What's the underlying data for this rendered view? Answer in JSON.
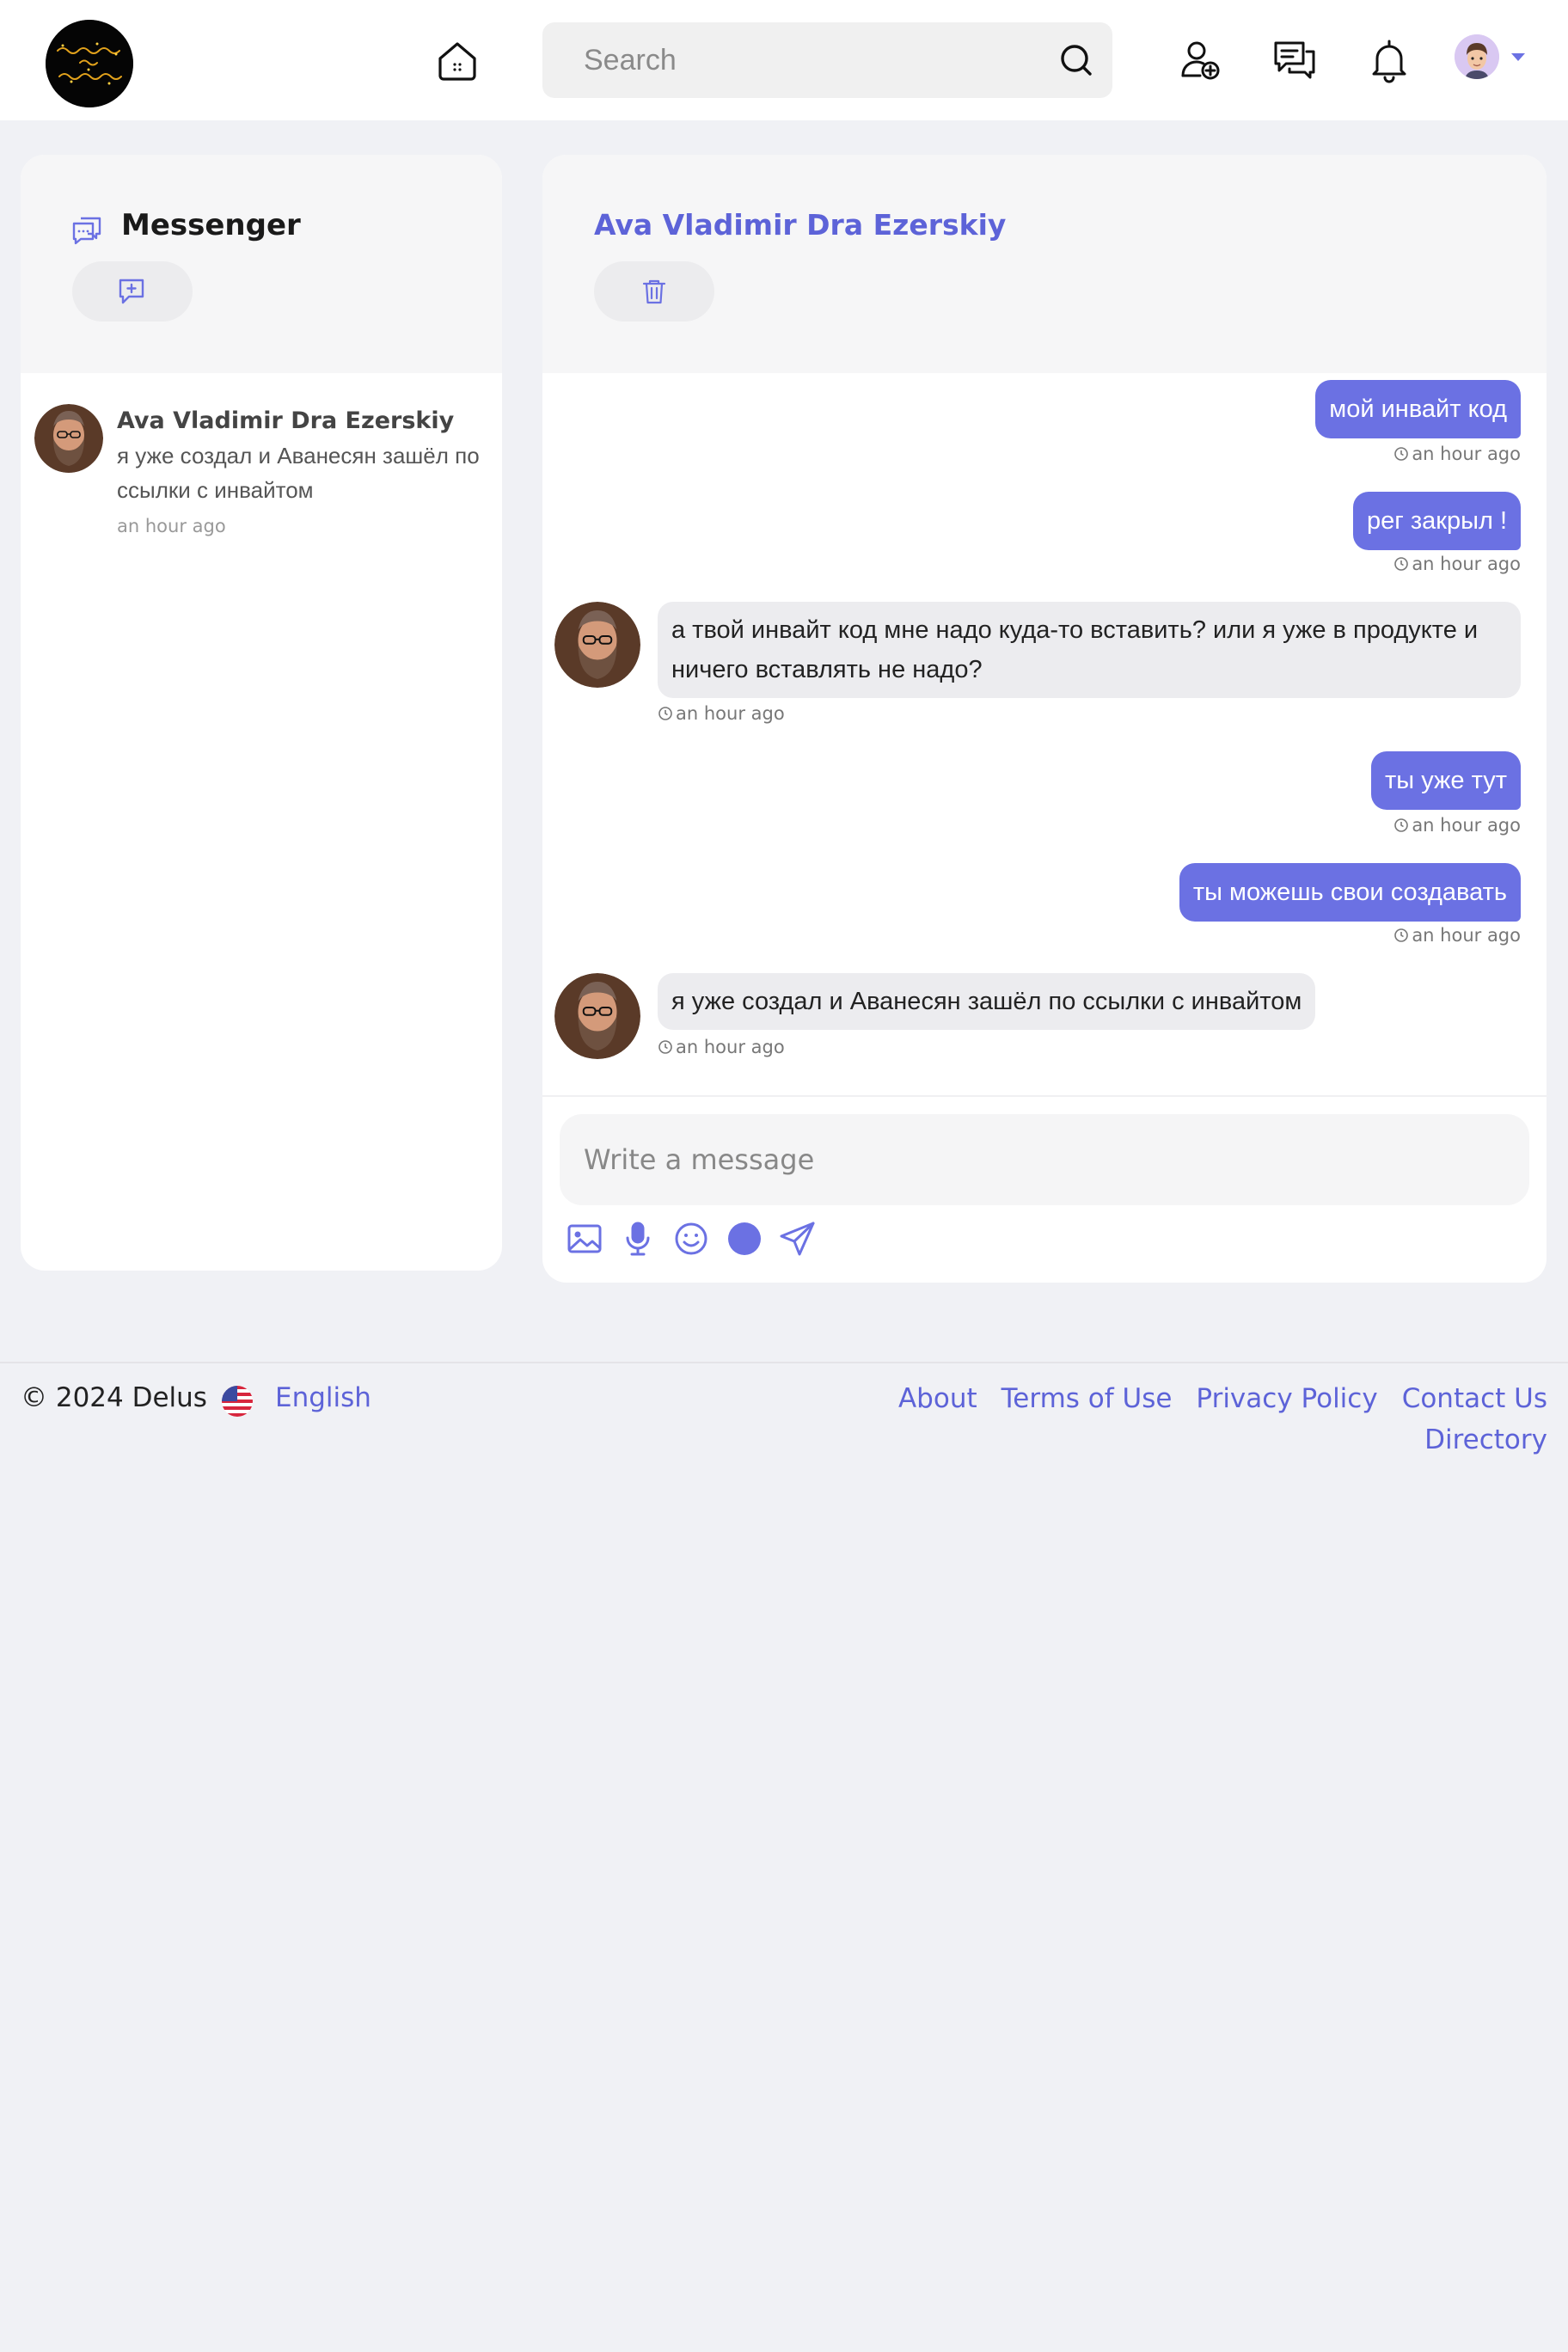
{
  "header": {
    "search_placeholder": "Search",
    "icons": [
      "home-icon",
      "search-icon",
      "add-friend-icon",
      "messages-icon",
      "bell-icon",
      "avatar",
      "caret-down-icon"
    ]
  },
  "sidebar": {
    "title": "Messenger",
    "conversations": [
      {
        "name": "Ava Vladimir Dra Ezerskiy",
        "preview": "я уже создал и Аванесян зашёл по ссылки с инвайтом",
        "time": "an hour ago"
      }
    ]
  },
  "chat": {
    "contact_name": "Ava Vladimir Dra Ezerskiy",
    "messages": [
      {
        "direction": "out",
        "text": "мой инвайт код",
        "time": "an hour ago"
      },
      {
        "direction": "out",
        "text": "рег закрыл !",
        "time": "an hour ago"
      },
      {
        "direction": "in",
        "text": "а твой инвайт код мне надо куда-то вставить? или я уже в продукте и ничего вставлять не надо?",
        "time": "an hour ago"
      },
      {
        "direction": "out",
        "text": "ты уже тут",
        "time": "an hour ago"
      },
      {
        "direction": "out",
        "text": "ты можешь свои создавать",
        "time": "an hour ago"
      },
      {
        "direction": "in",
        "text": "я уже создал и Аванесян зашёл по ссылки с инвайтом",
        "time": "an hour ago"
      }
    ],
    "composer_placeholder": "Write a message"
  },
  "footer": {
    "copyright": "© 2024 Delus",
    "language": "English",
    "links": [
      "About",
      "Terms of Use",
      "Privacy Policy",
      "Contact Us",
      "Directory"
    ]
  },
  "colors": {
    "accent": "#6b71e3",
    "link": "#5d63d8",
    "page_bg": "#f0f1f5",
    "bubble_in": "#ececef"
  }
}
